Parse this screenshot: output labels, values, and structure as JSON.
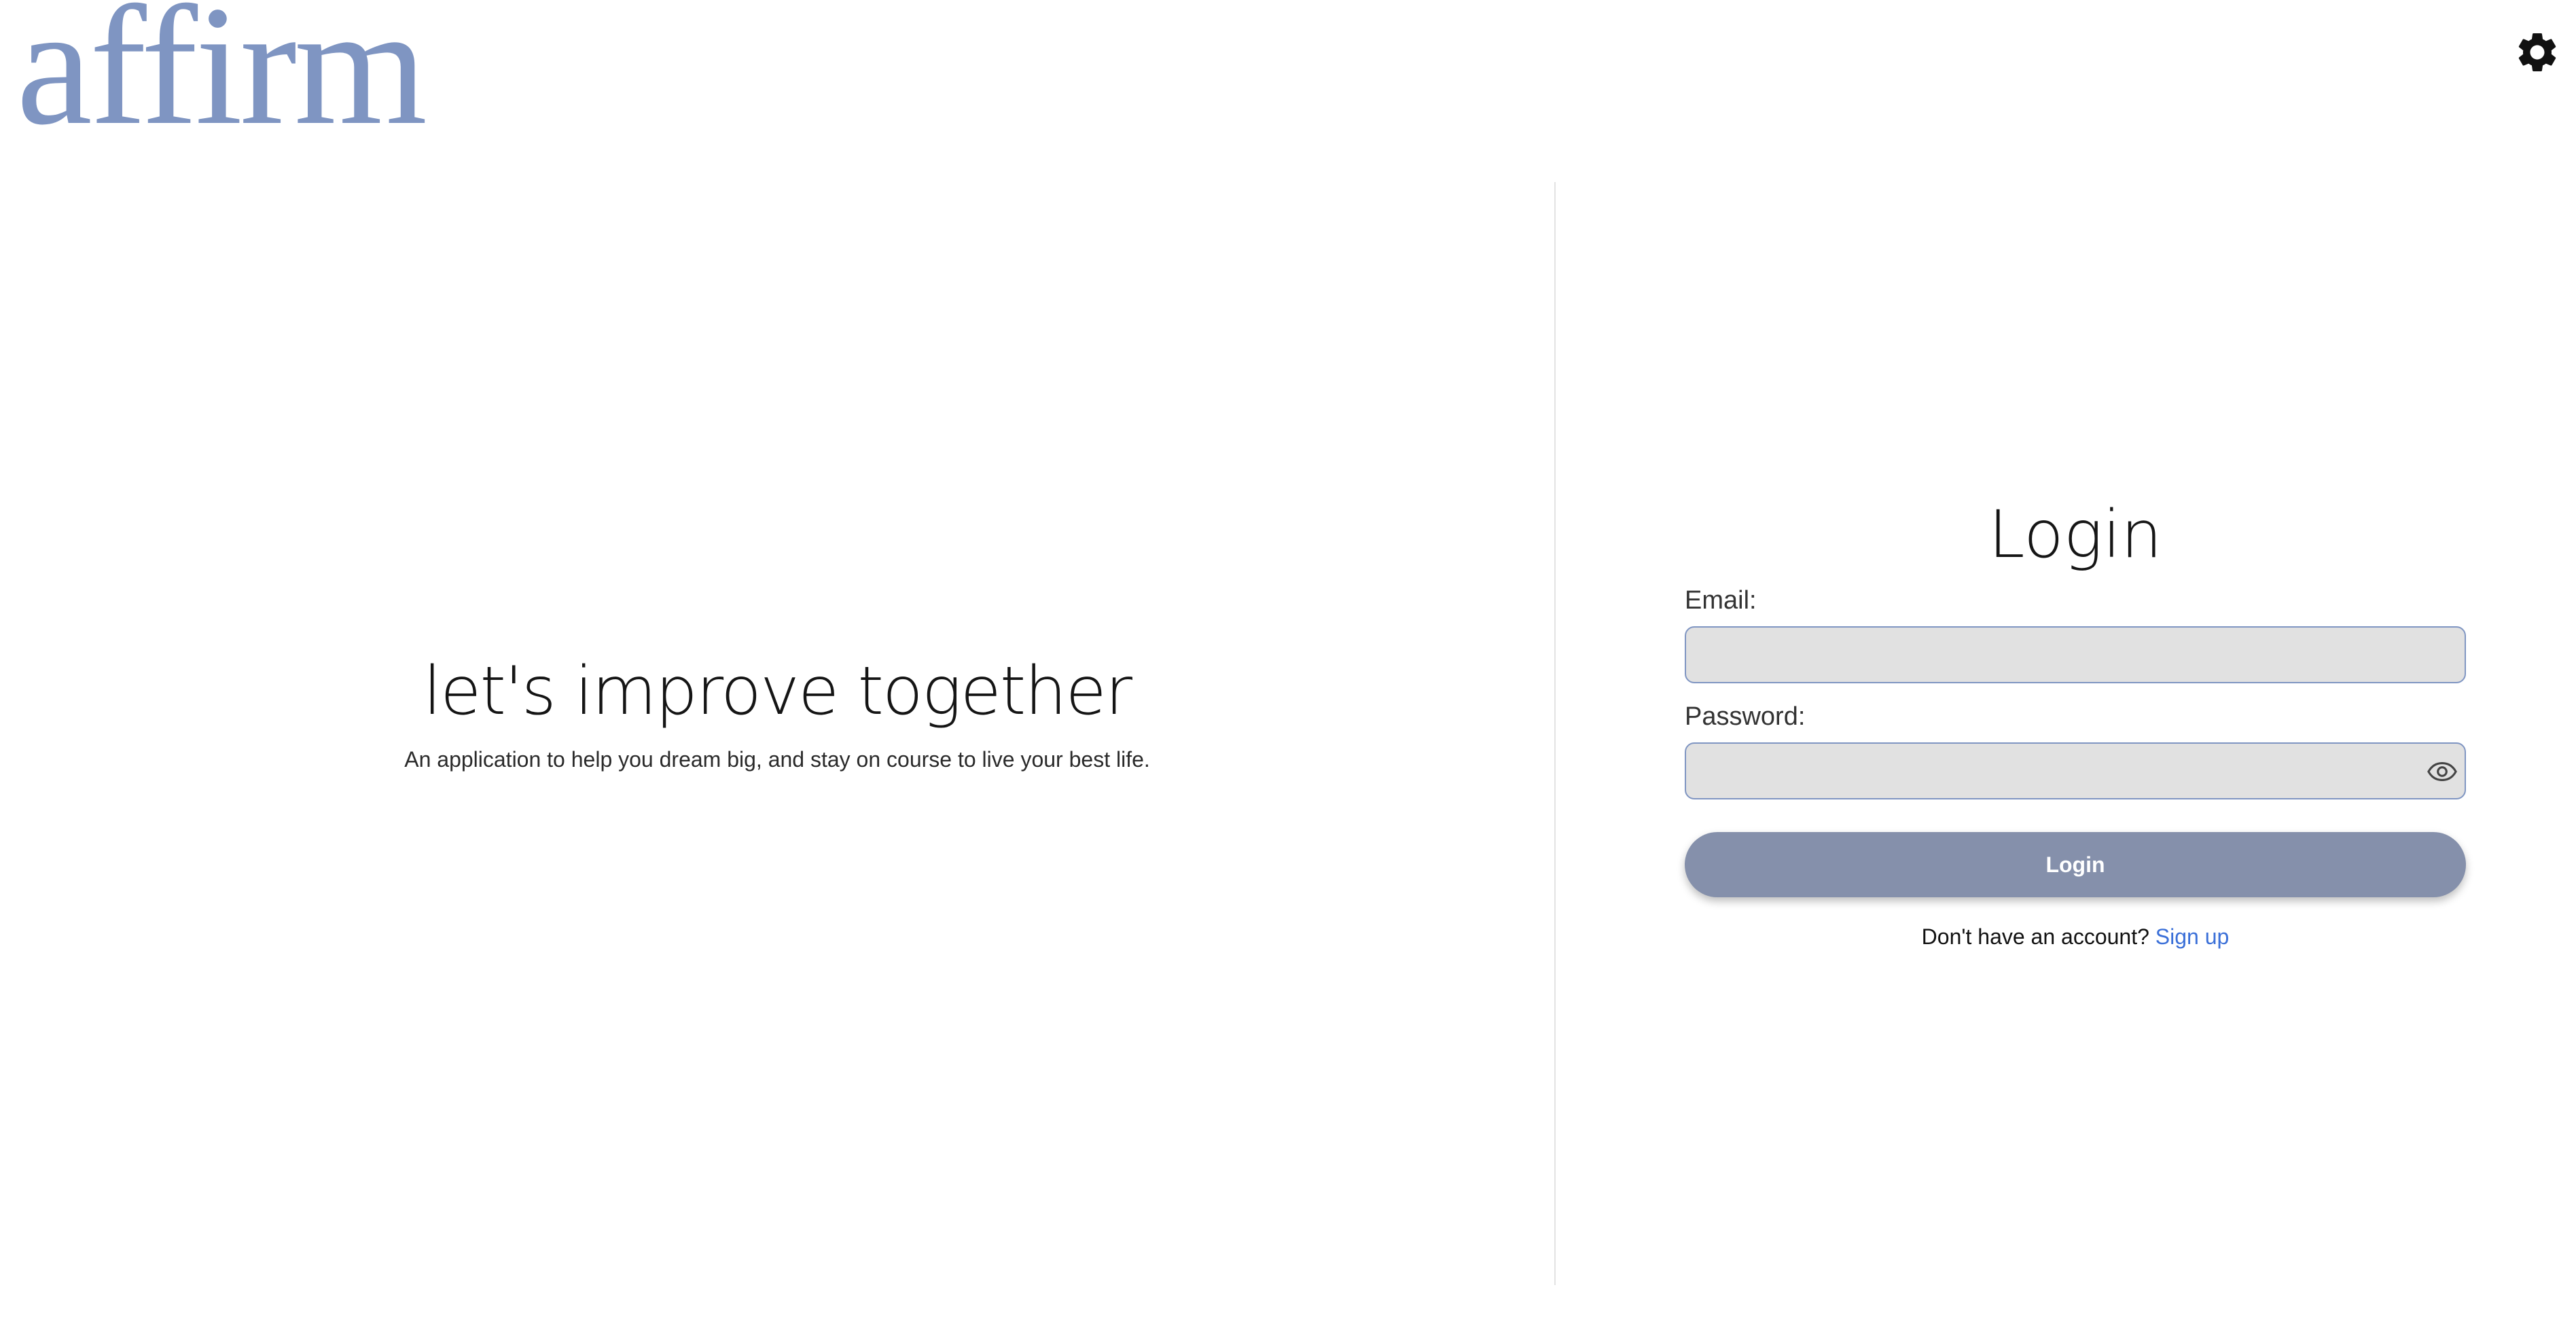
{
  "brand": {
    "logo_text": "affirm",
    "logo_color": "#7f95c2"
  },
  "header": {
    "settings_icon": "gear-icon"
  },
  "hero": {
    "title": "let's improve together",
    "subtitle": "An application to help you dream big, and stay on course to live your best life."
  },
  "login": {
    "title": "Login",
    "email_label": "Email:",
    "email_value": "",
    "password_label": "Password:",
    "password_value": "",
    "password_toggle_icon": "eye-icon",
    "submit_label": "Login",
    "signup_prompt": "Don't have an account?",
    "signup_link": "Sign up"
  },
  "colors": {
    "accent": "#7f95c2",
    "button": "#8590ab",
    "link": "#3a6fd8",
    "input_bg": "#e1e1e1"
  }
}
